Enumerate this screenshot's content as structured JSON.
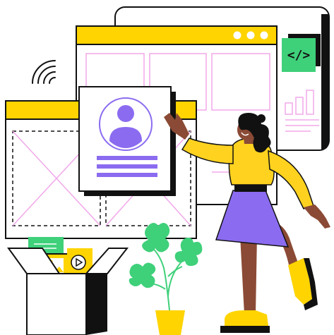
{
  "illustration": {
    "code_badge_text": "</>"
  },
  "colors": {
    "ink": "#111111",
    "yellow": "#FFD400",
    "pink_wireframe": "#F2A8EA",
    "purple": "#8B6CF0",
    "purple_light": "#E8E2FF",
    "green": "#3FD07A",
    "skin": "#8B4A35",
    "skirt": "#8B6CF0",
    "sweater": "#FFD21F",
    "white": "#FFFFFF"
  },
  "icons": {
    "wifi": "wifi-signal-icon",
    "code": "code-icon",
    "avatar": "user-avatar-icon",
    "image": "image-icon",
    "play": "play-icon",
    "chart": "bar-chart-icon"
  }
}
